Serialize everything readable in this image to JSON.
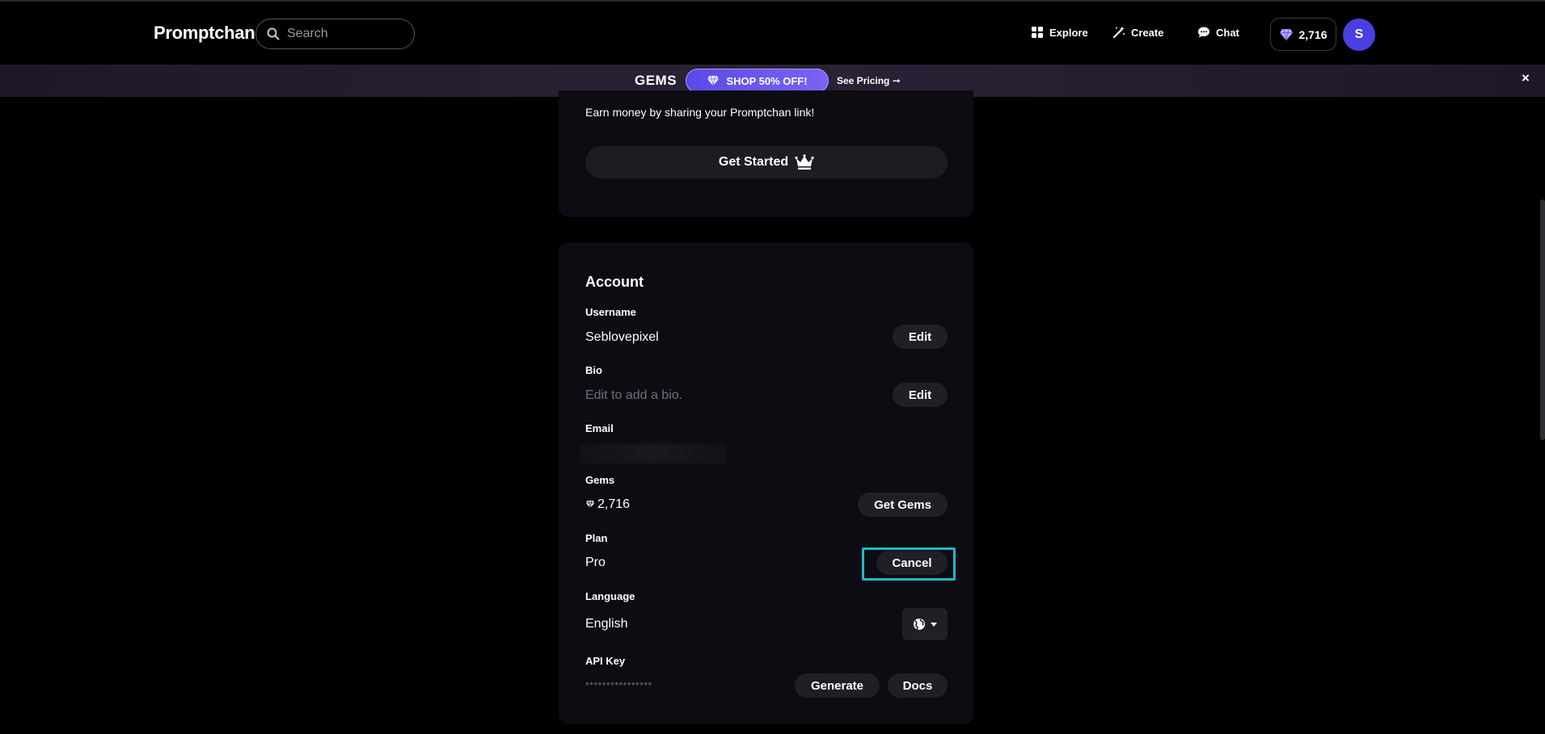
{
  "header": {
    "logo": "Promptchan",
    "search_placeholder": "Search",
    "nav": {
      "explore": "Explore",
      "create": "Create",
      "chat": "Chat"
    },
    "gems_count": "2,716",
    "avatar_initial": "S"
  },
  "banner": {
    "title": "GEMS",
    "shop_label": "SHOP 50% OFF!",
    "see_pricing": "See Pricing ➞",
    "close": "×"
  },
  "affiliate": {
    "text": "Earn money by sharing your Promptchan link!",
    "button": "Get Started"
  },
  "account": {
    "title": "Account",
    "username": {
      "label": "Username",
      "value": "Seblovepixel",
      "button": "Edit"
    },
    "bio": {
      "label": "Bio",
      "value": "Edit to add a bio.",
      "button": "Edit"
    },
    "email": {
      "label": "Email"
    },
    "gems": {
      "label": "Gems",
      "value": "2,716",
      "button": "Get Gems"
    },
    "plan": {
      "label": "Plan",
      "value": "Pro",
      "button": "Cancel"
    },
    "language": {
      "label": "Language",
      "value": "English"
    },
    "api_key": {
      "label": "API Key",
      "value": "****************",
      "generate": "Generate",
      "docs": "Docs"
    }
  },
  "colors": {
    "accent": "#5a4ae6",
    "avatar": "#4a3fe0",
    "highlight": "#1fb8c9",
    "card_bg": "#0c0c12"
  }
}
